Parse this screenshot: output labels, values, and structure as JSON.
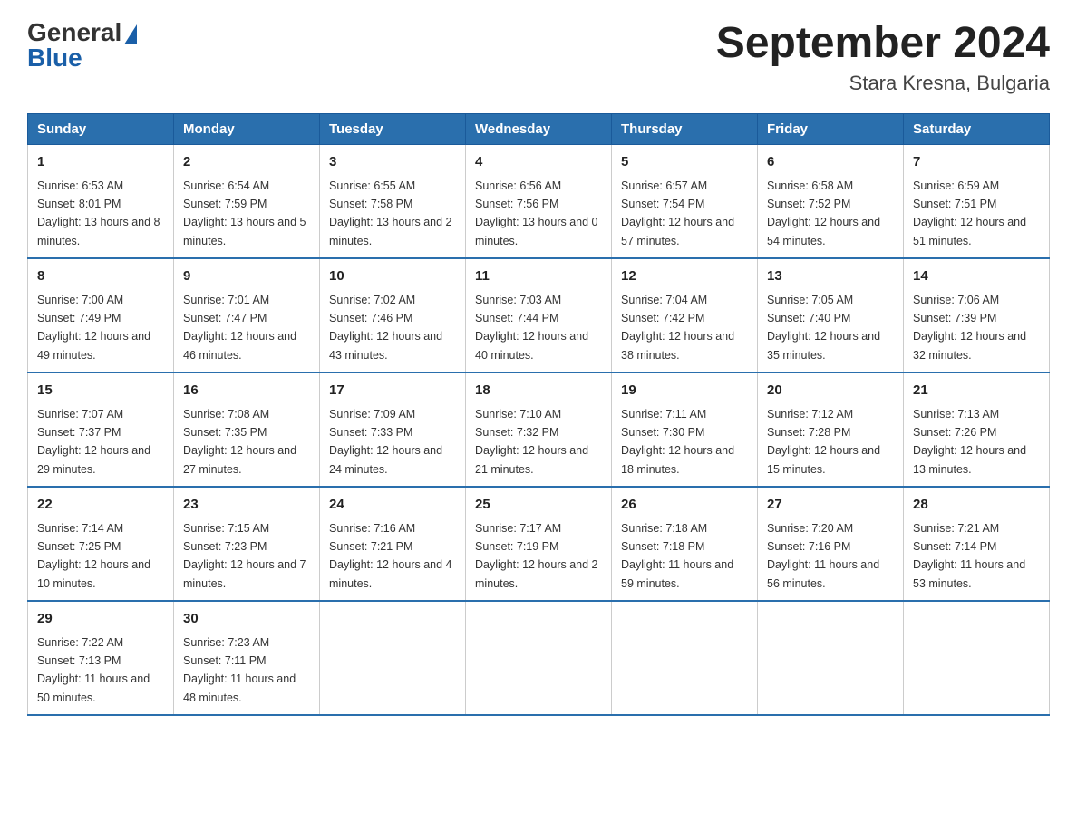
{
  "header": {
    "logo": {
      "text_general": "General",
      "text_blue": "Blue"
    },
    "title": "September 2024",
    "subtitle": "Stara Kresna, Bulgaria"
  },
  "weekdays": [
    "Sunday",
    "Monday",
    "Tuesday",
    "Wednesday",
    "Thursday",
    "Friday",
    "Saturday"
  ],
  "weeks": [
    [
      {
        "day": "1",
        "sunrise": "6:53 AM",
        "sunset": "8:01 PM",
        "daylight": "13 hours and 8 minutes."
      },
      {
        "day": "2",
        "sunrise": "6:54 AM",
        "sunset": "7:59 PM",
        "daylight": "13 hours and 5 minutes."
      },
      {
        "day": "3",
        "sunrise": "6:55 AM",
        "sunset": "7:58 PM",
        "daylight": "13 hours and 2 minutes."
      },
      {
        "day": "4",
        "sunrise": "6:56 AM",
        "sunset": "7:56 PM",
        "daylight": "13 hours and 0 minutes."
      },
      {
        "day": "5",
        "sunrise": "6:57 AM",
        "sunset": "7:54 PM",
        "daylight": "12 hours and 57 minutes."
      },
      {
        "day": "6",
        "sunrise": "6:58 AM",
        "sunset": "7:52 PM",
        "daylight": "12 hours and 54 minutes."
      },
      {
        "day": "7",
        "sunrise": "6:59 AM",
        "sunset": "7:51 PM",
        "daylight": "12 hours and 51 minutes."
      }
    ],
    [
      {
        "day": "8",
        "sunrise": "7:00 AM",
        "sunset": "7:49 PM",
        "daylight": "12 hours and 49 minutes."
      },
      {
        "day": "9",
        "sunrise": "7:01 AM",
        "sunset": "7:47 PM",
        "daylight": "12 hours and 46 minutes."
      },
      {
        "day": "10",
        "sunrise": "7:02 AM",
        "sunset": "7:46 PM",
        "daylight": "12 hours and 43 minutes."
      },
      {
        "day": "11",
        "sunrise": "7:03 AM",
        "sunset": "7:44 PM",
        "daylight": "12 hours and 40 minutes."
      },
      {
        "day": "12",
        "sunrise": "7:04 AM",
        "sunset": "7:42 PM",
        "daylight": "12 hours and 38 minutes."
      },
      {
        "day": "13",
        "sunrise": "7:05 AM",
        "sunset": "7:40 PM",
        "daylight": "12 hours and 35 minutes."
      },
      {
        "day": "14",
        "sunrise": "7:06 AM",
        "sunset": "7:39 PM",
        "daylight": "12 hours and 32 minutes."
      }
    ],
    [
      {
        "day": "15",
        "sunrise": "7:07 AM",
        "sunset": "7:37 PM",
        "daylight": "12 hours and 29 minutes."
      },
      {
        "day": "16",
        "sunrise": "7:08 AM",
        "sunset": "7:35 PM",
        "daylight": "12 hours and 27 minutes."
      },
      {
        "day": "17",
        "sunrise": "7:09 AM",
        "sunset": "7:33 PM",
        "daylight": "12 hours and 24 minutes."
      },
      {
        "day": "18",
        "sunrise": "7:10 AM",
        "sunset": "7:32 PM",
        "daylight": "12 hours and 21 minutes."
      },
      {
        "day": "19",
        "sunrise": "7:11 AM",
        "sunset": "7:30 PM",
        "daylight": "12 hours and 18 minutes."
      },
      {
        "day": "20",
        "sunrise": "7:12 AM",
        "sunset": "7:28 PM",
        "daylight": "12 hours and 15 minutes."
      },
      {
        "day": "21",
        "sunrise": "7:13 AM",
        "sunset": "7:26 PM",
        "daylight": "12 hours and 13 minutes."
      }
    ],
    [
      {
        "day": "22",
        "sunrise": "7:14 AM",
        "sunset": "7:25 PM",
        "daylight": "12 hours and 10 minutes."
      },
      {
        "day": "23",
        "sunrise": "7:15 AM",
        "sunset": "7:23 PM",
        "daylight": "12 hours and 7 minutes."
      },
      {
        "day": "24",
        "sunrise": "7:16 AM",
        "sunset": "7:21 PM",
        "daylight": "12 hours and 4 minutes."
      },
      {
        "day": "25",
        "sunrise": "7:17 AM",
        "sunset": "7:19 PM",
        "daylight": "12 hours and 2 minutes."
      },
      {
        "day": "26",
        "sunrise": "7:18 AM",
        "sunset": "7:18 PM",
        "daylight": "11 hours and 59 minutes."
      },
      {
        "day": "27",
        "sunrise": "7:20 AM",
        "sunset": "7:16 PM",
        "daylight": "11 hours and 56 minutes."
      },
      {
        "day": "28",
        "sunrise": "7:21 AM",
        "sunset": "7:14 PM",
        "daylight": "11 hours and 53 minutes."
      }
    ],
    [
      {
        "day": "29",
        "sunrise": "7:22 AM",
        "sunset": "7:13 PM",
        "daylight": "11 hours and 50 minutes."
      },
      {
        "day": "30",
        "sunrise": "7:23 AM",
        "sunset": "7:11 PM",
        "daylight": "11 hours and 48 minutes."
      },
      null,
      null,
      null,
      null,
      null
    ]
  ]
}
